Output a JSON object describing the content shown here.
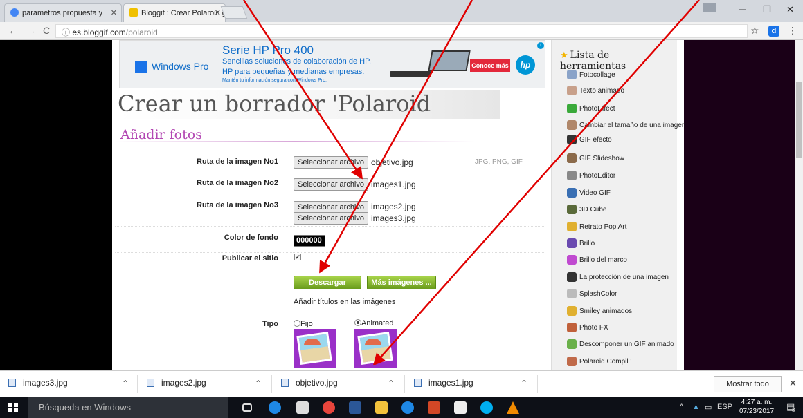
{
  "browser": {
    "tabs": [
      {
        "label": "parametros propuesta y",
        "active": false
      },
      {
        "label": "Bloggif : Crear Polaroid g",
        "active": true
      }
    ],
    "url_host": "es.bloggif.com",
    "url_path": "/polaroid",
    "extension_label": "d"
  },
  "ad": {
    "brand": "Windows Pro",
    "title": "Serie HP Pro 400",
    "line1": "Sencillas soluciones de colaboración de HP.",
    "line2": "HP para pequeñas y medianas empresas.",
    "small": "Mantén tu información segura con Windows Pro.",
    "cta": "Conoce más",
    "logo": "hp"
  },
  "page": {
    "title": "Crear un borrador 'Polaroid",
    "section": "Añadir fotos",
    "rows": [
      {
        "label": "Ruta de la imagen No1",
        "button": "Seleccionar archivo",
        "file": "objetivo.jpg",
        "formats": "JPG, PNG, GIF"
      },
      {
        "label": "Ruta de la imagen No2",
        "button": "Seleccionar archivo",
        "file": "images1.jpg"
      },
      {
        "label": "Ruta de la imagen No3",
        "button": "Seleccionar archivo",
        "file": "images2.jpg"
      },
      {
        "label": "",
        "button": "Seleccionar archivo",
        "file": "images3.jpg"
      }
    ],
    "color_label": "Color de fondo",
    "color_value": "000000",
    "publish_label": "Publicar el sitio",
    "publish_checked": true,
    "download_button": "Descargar",
    "more_images_button": "Más imágenes ...",
    "add_titles_link": "Añadir títulos en las imágenes",
    "type_label": "Tipo",
    "type_options": [
      "Fijo",
      "Animated"
    ],
    "type_selected": "Animated"
  },
  "sidebar": {
    "title": "Lista de herramientas",
    "items": [
      {
        "label": "Fotocollage",
        "color": "#8aa3c8"
      },
      {
        "label": "Texto animado",
        "color": "#c8a08a"
      },
      {
        "label": "PhotoEffect",
        "color": "#3aa93a"
      },
      {
        "label": "Cambiar el tamaño de una imagen",
        "color": "#b0876a"
      },
      {
        "label": "GIF efecto",
        "color": "#333333"
      },
      {
        "label": "GIF Slideshow",
        "color": "#8b6a4a"
      },
      {
        "label": "PhotoEditor",
        "color": "#888888"
      },
      {
        "label": "Video GIF",
        "color": "#3a6fb3"
      },
      {
        "label": "3D Cube",
        "color": "#5a6a3a"
      },
      {
        "label": "Retrato Pop Art",
        "color": "#e0b030"
      },
      {
        "label": "Brillo",
        "color": "#6a4ab0"
      },
      {
        "label": "Brillo del marco",
        "color": "#c04ad0"
      },
      {
        "label": "La protección de una imagen",
        "color": "#333333"
      },
      {
        "label": "SplashColor",
        "color": "#bbbbbb"
      },
      {
        "label": "Smiley animados",
        "color": "#e0b030"
      },
      {
        "label": "Photo FX",
        "color": "#c0603a"
      },
      {
        "label": "Descomponer un GIF animado",
        "color": "#6ab04a"
      },
      {
        "label": "Polaroid Compil '",
        "color": "#c06a4a"
      }
    ]
  },
  "downloads": {
    "items": [
      "images3.jpg",
      "images2.jpg",
      "objetivo.jpg",
      "images1.jpg"
    ],
    "show_all": "Mostrar todo"
  },
  "taskbar": {
    "search_placeholder": "Búsqueda en Windows",
    "lang": "ESP",
    "time": "4:27 a. m.",
    "date": "07/23/2017",
    "notifications": "3"
  },
  "colors": {
    "annotation_arrow": "#e00000",
    "accent_green": "#7cb32a",
    "section_purple": "#b347b3"
  }
}
